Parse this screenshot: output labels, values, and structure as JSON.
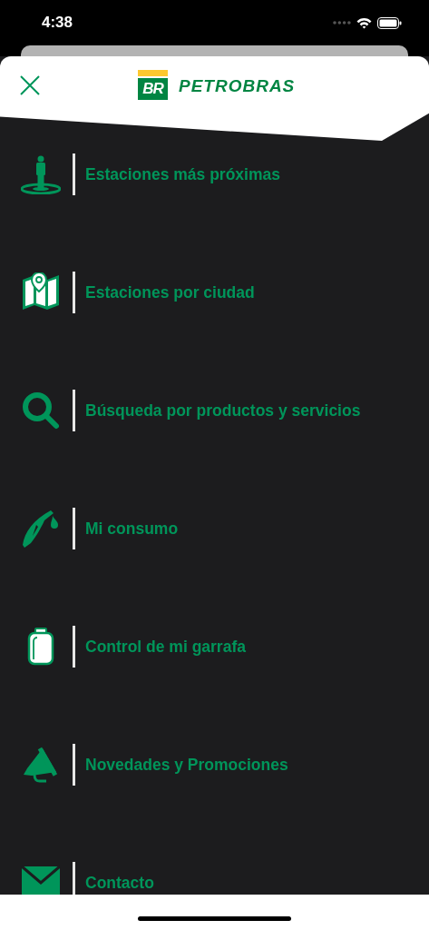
{
  "status_bar": {
    "time": "4:38"
  },
  "header": {
    "logo_mark": "BR",
    "logo_text": "PETROBRAS"
  },
  "menu": [
    {
      "kind": "person",
      "label": "Estaciones más próximas"
    },
    {
      "kind": "map",
      "label": "Estaciones por ciudad"
    },
    {
      "kind": "search",
      "label": "Búsqueda por productos y servicios"
    },
    {
      "kind": "nozzle",
      "label": "Mi consumo"
    },
    {
      "kind": "bottle",
      "label": "Control de mi garrafa"
    },
    {
      "kind": "megaphone",
      "label": "Novedades y Promociones"
    },
    {
      "kind": "mail",
      "label": "Contacto"
    }
  ]
}
